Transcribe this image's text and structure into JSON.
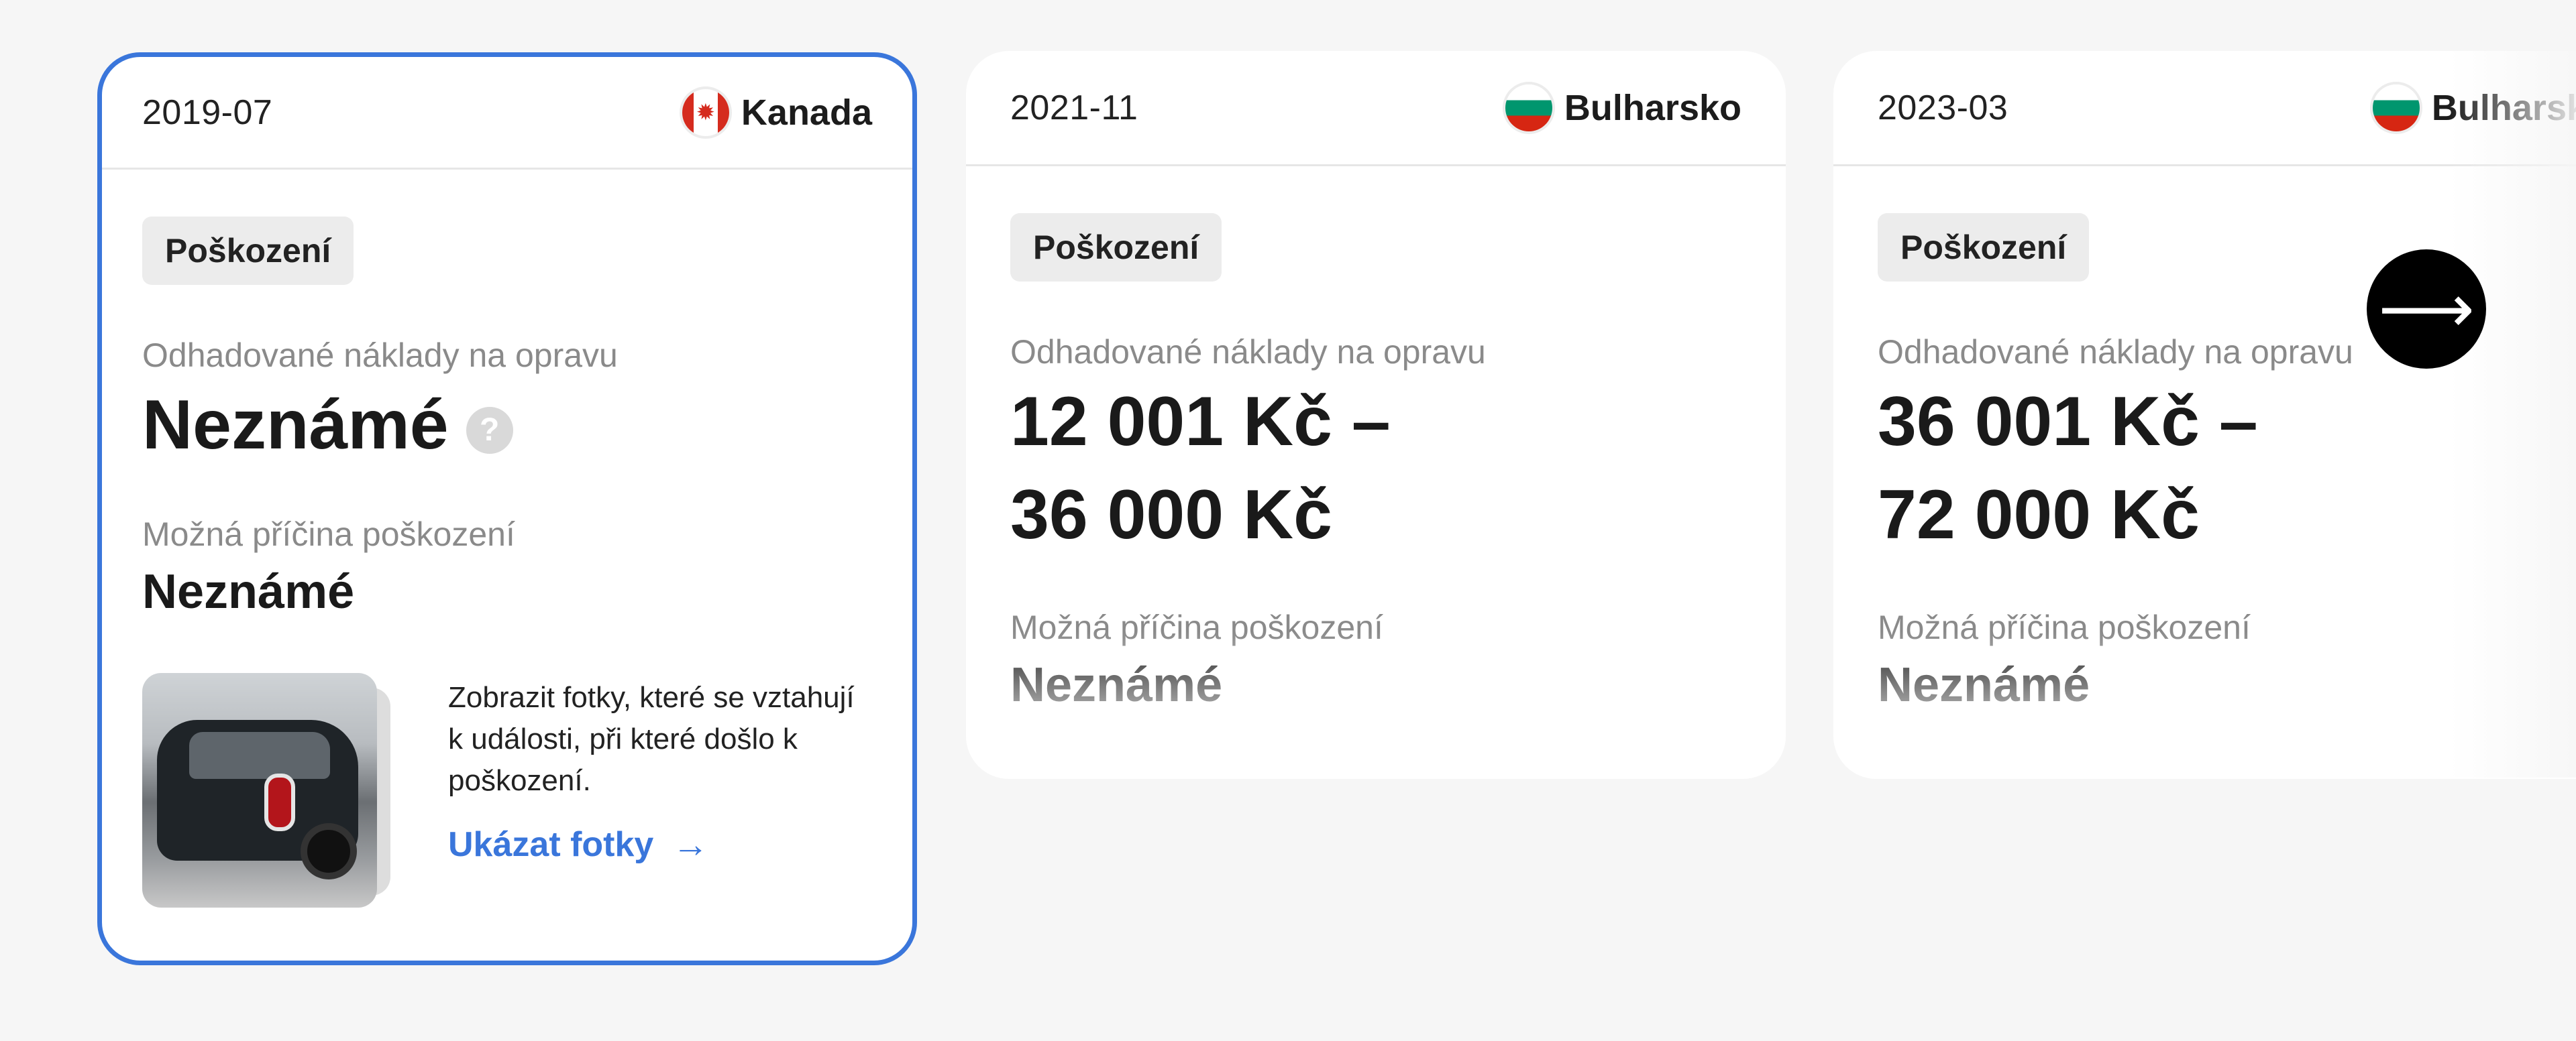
{
  "cards": [
    {
      "date": "2019-07",
      "country": "Kanada",
      "flag_icon": "canada-flag-icon",
      "badge": "Poškození",
      "cost_label": "Odhadované náklady na opravu",
      "cost_value": "Neznámé",
      "help_glyph": "?",
      "cause_label": "Možná příčina poškození",
      "cause_value": "Neznámé",
      "photos_description": "Zobrazit fotky, které se vztahují k události, při které došlo k poškození.",
      "photos_link": "Ukázat fotky",
      "link_arrow": "→"
    },
    {
      "date": "2021-11",
      "country": "Bulharsko",
      "flag_icon": "bulgaria-flag-icon",
      "badge": "Poškození",
      "cost_label": "Odhadované náklady na opravu",
      "cost_line1": "12 001 Kč –",
      "cost_line2": "36 000 Kč",
      "cause_label": "Možná příčina poškození",
      "cause_value": "Neznámé"
    },
    {
      "date": "2023-03",
      "country": "Bulharsko",
      "flag_icon": "bulgaria-flag-icon",
      "badge": "Poškození",
      "cost_label": "Odhadované náklady na opravu",
      "cost_line1": "36 001 Kč –",
      "cost_line2": "72 000 Kč",
      "cause_label": "Možná příčina poškození",
      "cause_value": "Neznámé"
    }
  ],
  "nav": {
    "next_glyph": "⟶"
  },
  "colors": {
    "accent": "#3a76db",
    "background": "#f6f6f6",
    "badge_bg": "#ececec",
    "muted_text": "#8a8a8a"
  }
}
